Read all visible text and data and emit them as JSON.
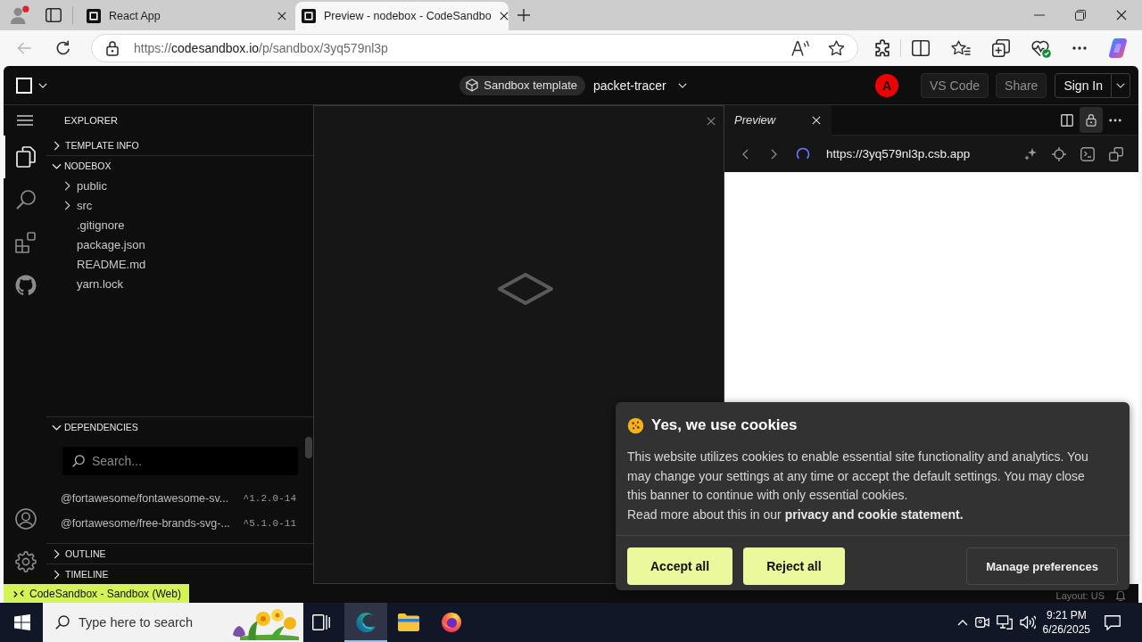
{
  "browser": {
    "tabs": [
      {
        "title": "React App",
        "selected": false
      },
      {
        "title": "Preview - nodebox - CodeSandbo",
        "selected": true
      }
    ],
    "address": {
      "scheme": "https://",
      "host": "codesandbox.io",
      "path": "/p/sandbox/3yq579nl3p"
    }
  },
  "header": {
    "badge": "Sandbox template",
    "project": "packet-tracer",
    "avatar": "A",
    "buttons": [
      {
        "label": "VS Code",
        "kind": "plain"
      },
      {
        "label": "Share",
        "kind": "plain"
      },
      {
        "label": "Sign In",
        "kind": "split"
      }
    ]
  },
  "activity_bar": {
    "items": [
      {
        "kind": "files",
        "selected": true
      },
      {
        "kind": "search",
        "selected": false
      },
      {
        "kind": "extensions",
        "selected": false
      },
      {
        "kind": "github",
        "selected": false
      }
    ],
    "bottom": [
      {
        "kind": "account",
        "selected": false
      },
      {
        "kind": "settings",
        "selected": false
      }
    ]
  },
  "sidebar": {
    "title": "EXPLORER",
    "sections": [
      {
        "label": "TEMPLATE INFO",
        "kind": "plain",
        "expanded": false
      },
      {
        "label": "NODEBOX",
        "kind": "tree",
        "expanded": true,
        "items": [
          {
            "name": "public",
            "kind": "folder",
            "expanded": false
          },
          {
            "name": "src",
            "kind": "folder",
            "expanded": false
          },
          {
            "name": ".gitignore",
            "kind": "file"
          },
          {
            "name": "package.json",
            "kind": "file"
          },
          {
            "name": "README.md",
            "kind": "file"
          },
          {
            "name": "yarn.lock",
            "kind": "file"
          }
        ]
      },
      {
        "label": "DEPENDENCIES",
        "kind": "dependencies",
        "expanded": true,
        "search": {
          "placeholder": "Search..."
        },
        "items": [
          {
            "name": "@fortawesome/fontawesome-sv...",
            "version": "^1.2.0-14"
          },
          {
            "name": "@fortawesome/free-brands-svg-...",
            "version": "^5.1.0-11"
          }
        ]
      },
      {
        "label": "OUTLINE",
        "kind": "plain",
        "expanded": false
      },
      {
        "label": "TIMELINE",
        "kind": "plain",
        "expanded": false
      }
    ]
  },
  "preview": {
    "tab": {
      "label": "Preview",
      "selected": true
    },
    "tools": [
      {
        "kind": "split",
        "on": false
      },
      {
        "kind": "lock",
        "on": true
      },
      {
        "kind": "more",
        "on": false
      }
    ],
    "loading": true,
    "url": "https://3yq579nl3p.csb.app"
  },
  "cookie_banner": {
    "title": "Yes, we use cookies",
    "text": "This website utilizes cookies to enable essential site functionality and analytics. You may change your settings at any time or accept the default settings. You may close this banner to continue with only essential cookies.",
    "read_more": {
      "text": "Read more about this in our",
      "link": "privacy and cookie statement."
    },
    "buttons": [
      {
        "label": "Accept all",
        "kind": "accent"
      },
      {
        "label": "Reject all",
        "kind": "accent"
      },
      {
        "label": "Manage preferences",
        "kind": "outline"
      }
    ]
  },
  "status_bar": {
    "remote": "CodeSandbox - Sandbox (Web)",
    "layout": "Layout: US"
  },
  "taskbar": {
    "search": {
      "placeholder": "Type here to search"
    },
    "apps": [
      {
        "kind": "edge",
        "selected": true
      },
      {
        "kind": "explorer",
        "selected": false
      },
      {
        "kind": "firefox",
        "selected": false
      }
    ],
    "time": "9:21 PM",
    "date": "6/26/2025"
  }
}
